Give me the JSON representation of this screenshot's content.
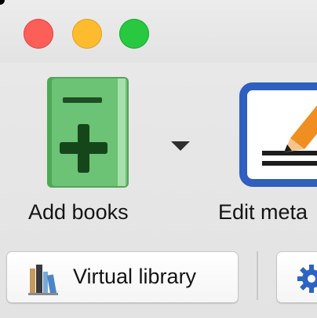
{
  "titlebar": {
    "buttons": {
      "close": "close-button",
      "minimize": "minimize-button",
      "zoom": "zoom-button"
    },
    "colors": {
      "close": "#fc5f57",
      "minimize": "#fdbc2e",
      "zoom": "#28c840"
    }
  },
  "toolbar": {
    "add_books": {
      "label": "Add books",
      "icon": "add-book-icon",
      "dropdown_icon": "dropdown-arrow-icon",
      "color": "#5fb768"
    },
    "edit_metadata": {
      "label": "Edit meta",
      "icon": "edit-metadata-icon",
      "color": "#2f5fbf"
    }
  },
  "searchbar": {
    "virtual_library": {
      "label": "Virtual library",
      "icon": "bookshelf-icon"
    },
    "preferences": {
      "icon": "gear-icon",
      "color": "#2c63c4"
    }
  }
}
